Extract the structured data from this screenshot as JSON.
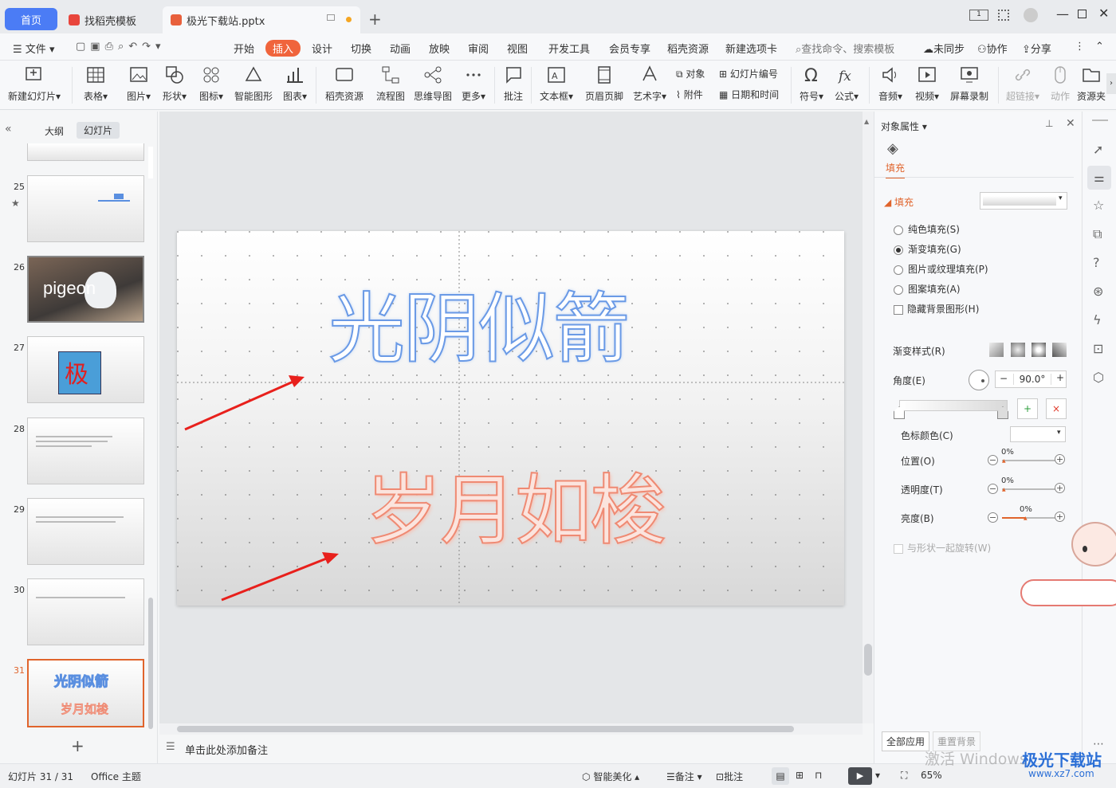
{
  "tabs": {
    "home": "首页",
    "template": "找稻壳模板",
    "doc": "极光下载站.pptx"
  },
  "menu": [
    "文件",
    "开始",
    "插入",
    "设计",
    "切换",
    "动画",
    "放映",
    "审阅",
    "视图",
    "开发工具",
    "会员专享",
    "稻壳资源",
    "新建选项卡"
  ],
  "menu_right": {
    "search": "查找命令、搜索模板",
    "sync": "未同步",
    "collab": "协作",
    "share": "分享"
  },
  "ribbon": {
    "new_slide": "新建幻灯片",
    "table": "表格",
    "picture": "图片",
    "shape": "形状",
    "icon": "图标",
    "smart": "智能图形",
    "chart": "图表",
    "docer": "稻壳资源",
    "flow": "流程图",
    "mind": "思维导图",
    "more": "更多",
    "comment": "批注",
    "textbox": "文本框",
    "header": "页眉页脚",
    "art": "艺术字",
    "object": "对象",
    "attach": "附件",
    "slidenum": "幻灯片编号",
    "datetime": "日期和时间",
    "symbol": "符号",
    "formula": "公式",
    "audio": "音频",
    "video": "视频",
    "record": "屏幕录制",
    "hyperlink": "超链接",
    "action": "动作",
    "resource": "资源夹"
  },
  "leftpane": {
    "outline": "大纲",
    "slides": "幻灯片",
    "thumbs": [
      {
        "num": "25"
      },
      {
        "num": "26",
        "text": "pigeon"
      },
      {
        "num": "27",
        "text": "极"
      },
      {
        "num": "28"
      },
      {
        "num": "29"
      },
      {
        "num": "30"
      },
      {
        "num": "31",
        "t1": "光阴似箭",
        "t2": "岁月如梭"
      }
    ]
  },
  "slide": {
    "line1": "光阴似箭",
    "line2": "岁月如梭"
  },
  "notes": "单击此处添加备注",
  "rightpane": {
    "title": "对象属性",
    "tab": "填充",
    "section": "填充",
    "options": [
      "纯色填充(S)",
      "渐变填充(G)",
      "图片或纹理填充(P)",
      "图案填充(A)"
    ],
    "hide_bg": "隐藏背景图形(H)",
    "grad_style": "渐变样式(R)",
    "angle": "角度(E)",
    "angle_val": "90.0°",
    "stop_color": "色标颜色(C)",
    "position": "位置(O)",
    "pos_val": "0%",
    "transparency": "透明度(T)",
    "trans_val": "0%",
    "brightness": "亮度(B)",
    "bright_val": "0%",
    "rotate": "与形状一起旋转(W)",
    "apply_all": "全部应用",
    "reset_bg": "重置背景"
  },
  "status": {
    "slide": "幻灯片 31 / 31",
    "theme": "Office 主题",
    "beautify": "智能美化",
    "notes": "备注",
    "comment": "批注",
    "zoom": "65%"
  },
  "watermark": {
    "activate": "激活 Windows",
    "brand": "极光下载站",
    "site": "www.xz7.com"
  },
  "colors": {
    "accent": "#4b7cf5",
    "insert": "#f0643c",
    "blue_text": "#5a8fe0",
    "red_text": "#ef8a73"
  }
}
